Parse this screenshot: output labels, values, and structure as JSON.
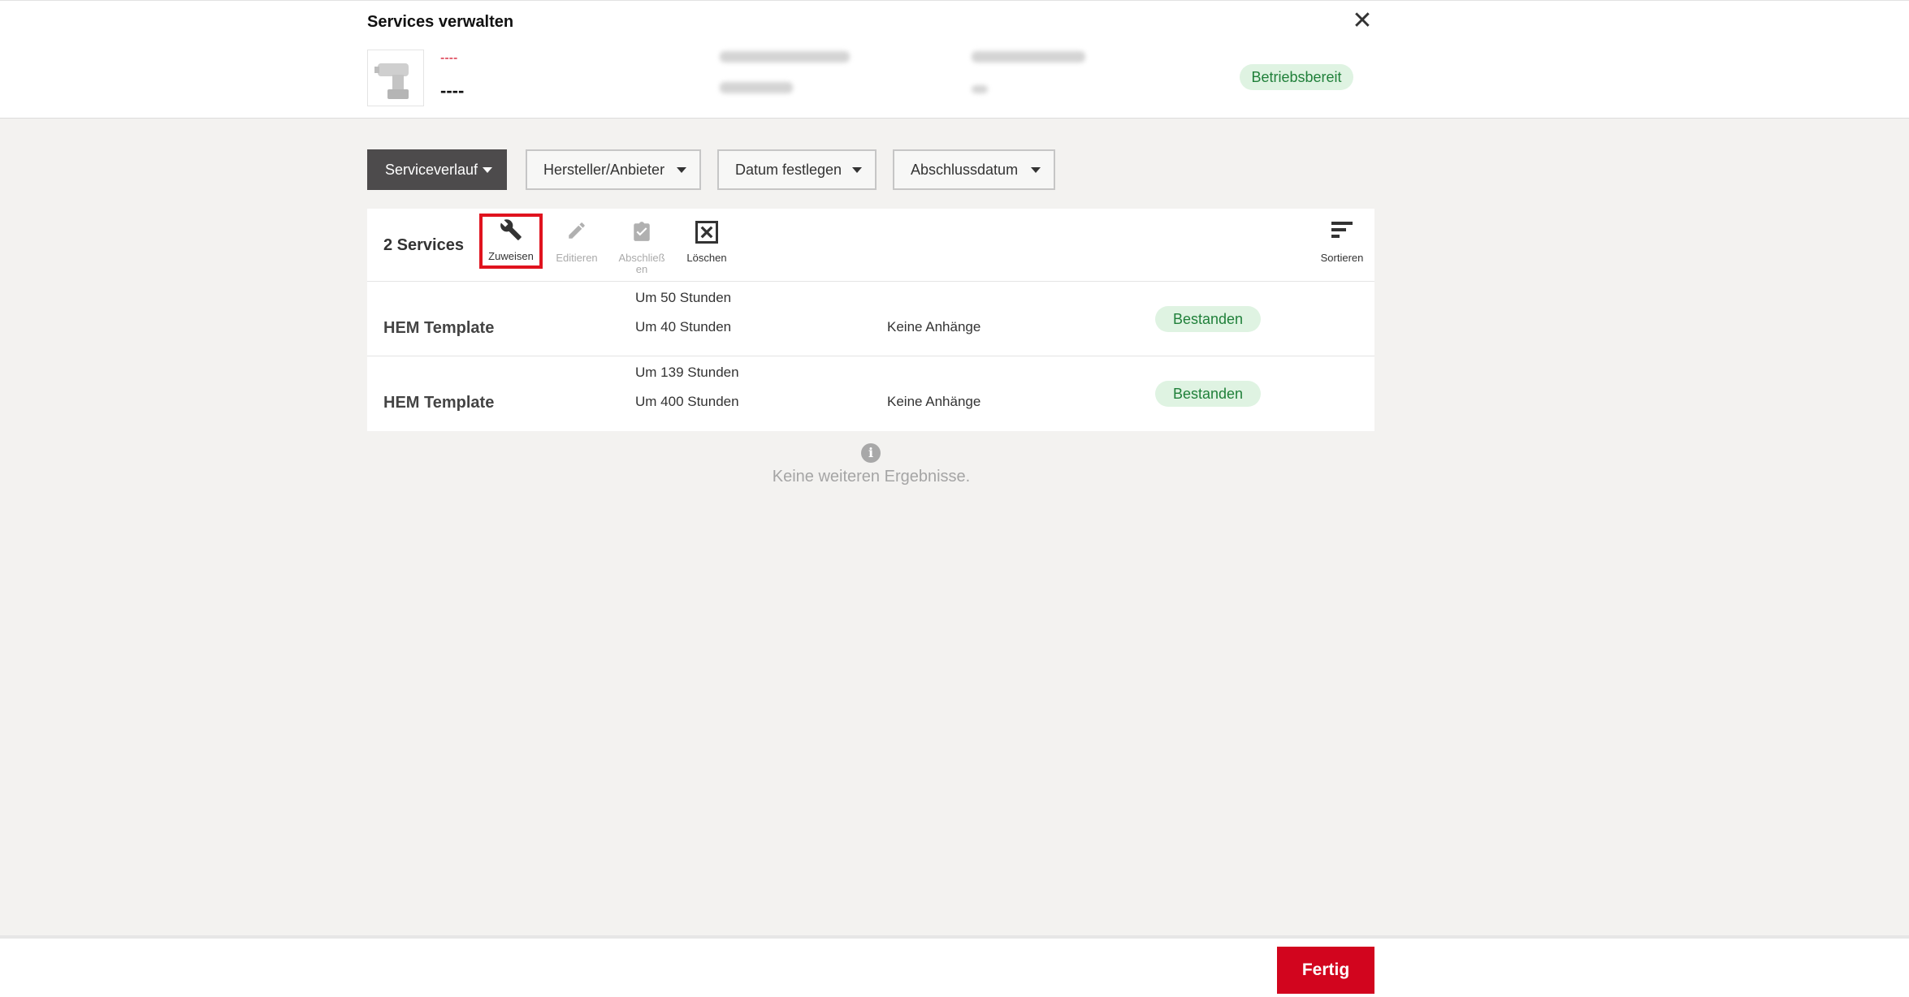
{
  "header": {
    "title": "Services verwalten",
    "close_icon": "close-icon",
    "product": {
      "code": "----",
      "name": "----",
      "thumbnail_icon": "drill-icon"
    },
    "status_badge": "Betriebsbereit"
  },
  "filters": [
    {
      "label": "Serviceverlauf",
      "active": true
    },
    {
      "label": "Hersteller/Anbieter",
      "active": false
    },
    {
      "label": "Datum festlegen",
      "active": false
    },
    {
      "label": "Abschlussdatum",
      "active": false
    }
  ],
  "toolbar": {
    "count_label": "2 Services",
    "actions": [
      {
        "label": "Zuweisen",
        "icon": "wrench-icon",
        "enabled": true,
        "selected": true
      },
      {
        "label": "Editieren",
        "icon": "pencil-icon",
        "enabled": false
      },
      {
        "label": "Abschließen",
        "icon": "clipboard-check-icon",
        "enabled": false
      },
      {
        "label": "Löschen",
        "icon": "delete-box-icon",
        "enabled": true
      }
    ],
    "sort_label": "Sortieren",
    "sort_icon": "sort-icon"
  },
  "services": [
    {
      "name": "HEM Template",
      "interval_1": "Um 50 Stunden",
      "interval_2": "Um 40 Stunden",
      "attachments": "Keine Anhänge",
      "status": "Bestanden"
    },
    {
      "name": "HEM Template",
      "interval_1": "Um 139 Stunden",
      "interval_2": "Um 400 Stunden",
      "attachments": "Keine Anhänge",
      "status": "Bestanden"
    }
  ],
  "no_more_results": "Keine weiteren Ergebnisse.",
  "footer": {
    "done_label": "Fertig"
  },
  "colors": {
    "accent": "#d2051e",
    "success_bg": "#dff3e2",
    "success_text": "#20803a",
    "dark_filter": "#4d4b4c"
  }
}
